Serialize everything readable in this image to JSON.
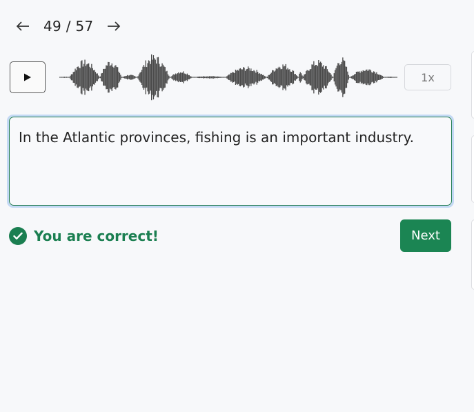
{
  "pager": {
    "prev_icon": "arrow-left-icon",
    "next_icon": "arrow-right-icon",
    "position": "49 / 57"
  },
  "audio": {
    "play_icon": "play-icon",
    "speed_label": "1x"
  },
  "answer": {
    "value": "In the Atlantic provinces, fishing is an important industry."
  },
  "feedback": {
    "icon": "check-circle-icon",
    "text": "You are correct!",
    "color": "#1b7f51"
  },
  "actions": {
    "next_label": "Next",
    "next_color": "#1b8553"
  }
}
